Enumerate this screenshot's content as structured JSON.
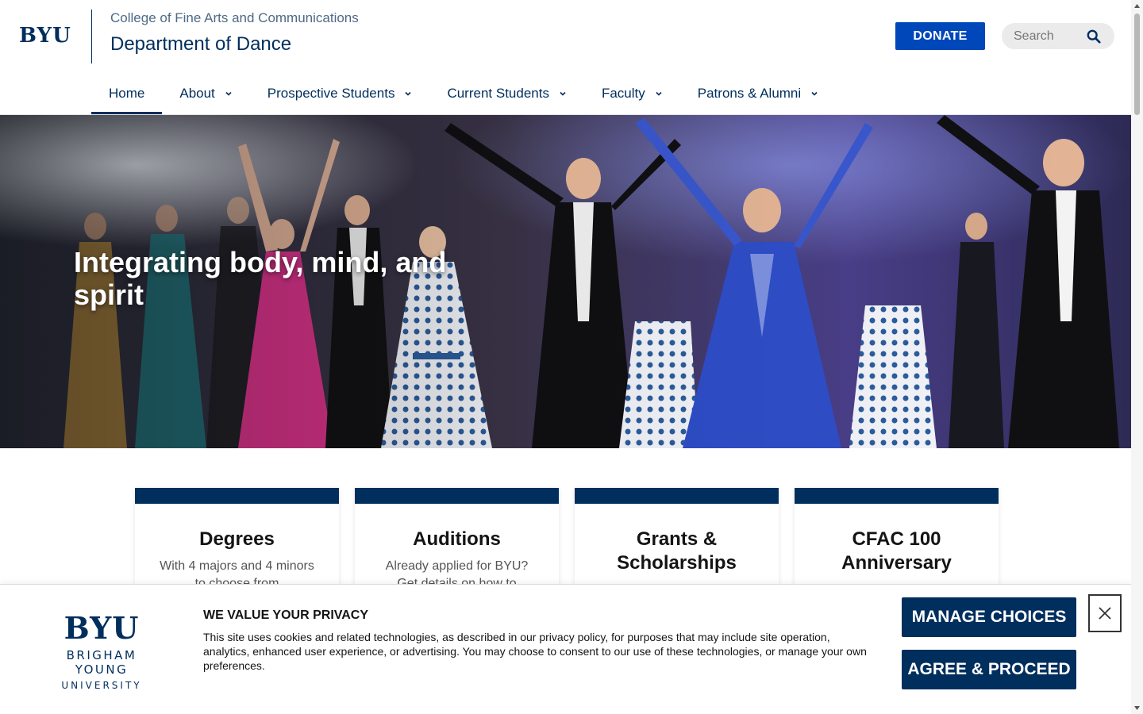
{
  "header": {
    "logo": "BYU",
    "college": "College of Fine Arts and Communications",
    "department": "Department of Dance",
    "donate_label": "DONATE",
    "search_placeholder": "Search"
  },
  "nav": {
    "items": [
      {
        "label": "Home",
        "active": true,
        "has_dropdown": false
      },
      {
        "label": "About",
        "has_dropdown": true
      },
      {
        "label": "Prospective Students",
        "has_dropdown": true
      },
      {
        "label": "Current Students",
        "has_dropdown": true
      },
      {
        "label": "Faculty",
        "has_dropdown": true
      },
      {
        "label": "Patrons & Alumni",
        "has_dropdown": true
      }
    ]
  },
  "hero": {
    "title": "Integrating body, mind, and spirit"
  },
  "cards": [
    {
      "title": "Degrees",
      "desc": "With 4 majors and 4 minors to choose from"
    },
    {
      "title": "Auditions",
      "desc": "Already applied for BYU? Get details on how to"
    },
    {
      "title": "Grants & Scholarships",
      "desc": ""
    },
    {
      "title": "CFAC 100 Anniversary",
      "desc": ""
    }
  ],
  "cookie": {
    "logo_mark": "BYU",
    "logo_line1": "BRIGHAM YOUNG",
    "logo_line2": "UNIVERSITY",
    "heading": "WE VALUE YOUR PRIVACY",
    "text": "This site uses cookies and related technologies, as described in our privacy policy, for purposes that may include site operation, analytics, enhanced user experience, or advertising. You may choose to consent to our use of these technologies, or manage your own preferences.",
    "manage_label": "MANAGE CHOICES",
    "agree_label": "AGREE & PROCEED"
  },
  "colors": {
    "navy": "#002E5D",
    "royal": "#0047BA"
  }
}
